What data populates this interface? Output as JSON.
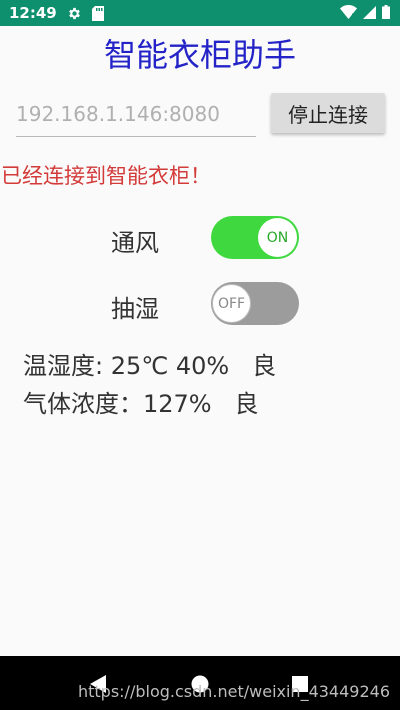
{
  "status_bar": {
    "time": "12:49",
    "icons_left": [
      "gear-icon",
      "sd-card-icon"
    ],
    "icons_right": [
      "wifi-icon",
      "signal-icon",
      "battery-icon"
    ],
    "background": "#0e8f6e"
  },
  "app": {
    "title": "智能衣柜助手",
    "title_color": "#2323c8",
    "ip_input": {
      "placeholder": "192.168.1.146:8080",
      "value": ""
    },
    "stop_button_label": "停止连接",
    "connection_status": "已经连接到智能衣柜！",
    "controls": [
      {
        "label": "通风",
        "state": "ON",
        "on": true
      },
      {
        "label": "抽湿",
        "state": "OFF",
        "on": false
      }
    ],
    "readouts": {
      "temperature_humidity": "温湿度: 25℃ 40%   良",
      "gas_concentration": "气体浓度：127%   良"
    }
  },
  "nav_bar": {
    "buttons": [
      "back-icon",
      "home-icon",
      "recents-icon"
    ],
    "watermark": "https://blog.csdn.net/weixin_43449246"
  }
}
